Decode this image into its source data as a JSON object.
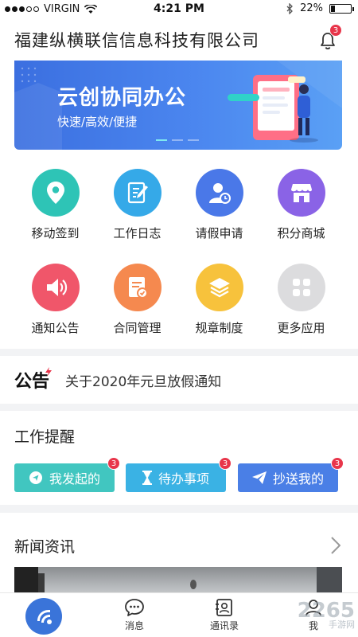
{
  "status_bar": {
    "carrier": "VIRGIN",
    "time": "4:21 PM",
    "battery": "22%",
    "battery_level": 0.22
  },
  "header": {
    "title": "福建纵横联信信息科技有限公司",
    "notification_count": "3"
  },
  "banner": {
    "title": "云创协同办公",
    "subtitle": "快速/高效/便捷",
    "page_count": 3,
    "active_page": 1
  },
  "apps": [
    {
      "label": "移动签到",
      "icon": "location-pin-icon",
      "color": "#2ec4b6"
    },
    {
      "label": "工作日志",
      "icon": "notebook-pen-icon",
      "color": "#35a9e8"
    },
    {
      "label": "请假申请",
      "icon": "person-clock-icon",
      "color": "#4a78e8"
    },
    {
      "label": "积分商城",
      "icon": "shop-icon",
      "color": "#8a63e6"
    },
    {
      "label": "通知公告",
      "icon": "speaker-icon",
      "color": "#f0566a"
    },
    {
      "label": "合同管理",
      "icon": "contract-icon",
      "color": "#f5894f"
    },
    {
      "label": "规章制度",
      "icon": "layers-icon",
      "color": "#f7c23c"
    },
    {
      "label": "更多应用",
      "icon": "grid-icon",
      "color": "#dcdcde"
    }
  ],
  "notice": {
    "tag": "公告",
    "text": "关于2020年元旦放假通知"
  },
  "work_reminder": {
    "title": "工作提醒",
    "items": [
      {
        "label": "我发起的",
        "count": "3",
        "color": "#41c6c0",
        "icon": "send-circle-icon"
      },
      {
        "label": "待办事项",
        "count": "3",
        "color": "#3ab2e4",
        "icon": "hourglass-icon"
      },
      {
        "label": "抄送我的",
        "count": "3",
        "color": "#4a7fe6",
        "icon": "paper-plane-icon"
      }
    ]
  },
  "news": {
    "title": "新闻资讯"
  },
  "tabbar": {
    "messages": "消息",
    "contacts": "通讯录",
    "me": "我"
  },
  "watermark": {
    "text": "2265",
    "sub": "手游网"
  }
}
